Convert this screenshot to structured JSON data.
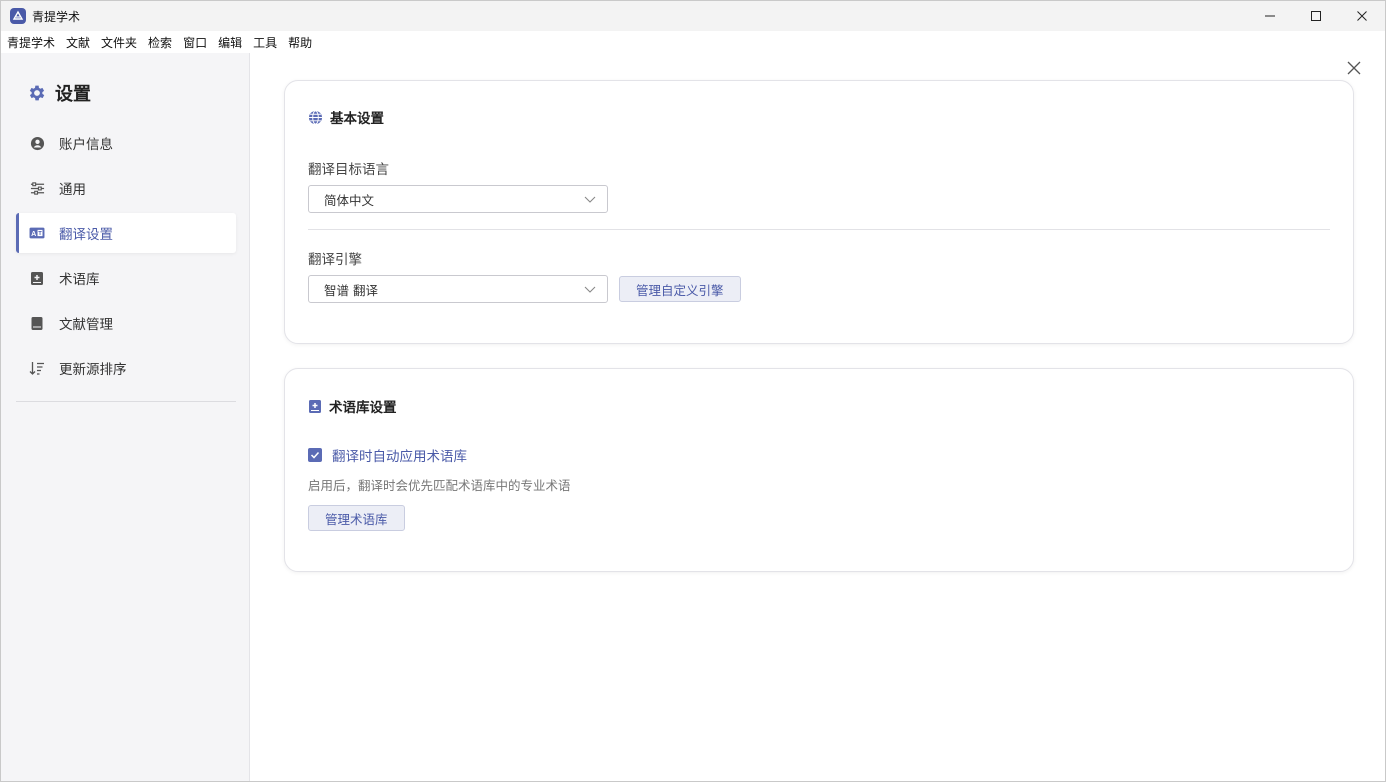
{
  "window": {
    "title": "青提学术",
    "icon": "app-logo-icon",
    "controls": [
      "minimize-icon",
      "maximize-icon",
      "close-icon"
    ]
  },
  "menubar": {
    "items": [
      "青提学术",
      "文献",
      "文件夹",
      "检索",
      "窗口",
      "编辑",
      "工具",
      "帮助"
    ]
  },
  "sidebar": {
    "title": "设置",
    "title_icon": "gear-icon",
    "items": [
      {
        "label": "账户信息",
        "icon": "user-icon",
        "active": false
      },
      {
        "label": "通用",
        "icon": "sliders-icon",
        "active": false
      },
      {
        "label": "翻译设置",
        "icon": "translate-icon",
        "active": true
      },
      {
        "label": "术语库",
        "icon": "term-book-icon",
        "active": false
      },
      {
        "label": "文献管理",
        "icon": "book-icon",
        "active": false
      },
      {
        "label": "更新源排序",
        "icon": "sort-icon",
        "active": false
      }
    ]
  },
  "main": {
    "close_icon": "close-icon",
    "basic": {
      "title": "基本设置",
      "icon": "globe-icon",
      "target_lang_label": "翻译目标语言",
      "target_lang_value": "简体中文",
      "engine_label": "翻译引擎",
      "engine_value": "智谱 翻译",
      "manage_engine_button": "管理自定义引擎"
    },
    "glossary": {
      "title": "术语库设置",
      "icon": "term-book-icon",
      "auto_apply_label": "翻译时自动应用术语库",
      "auto_apply_checked": true,
      "hint": "启用后，翻译时会优先匹配术语库中的专业术语",
      "manage_button": "管理术语库"
    }
  },
  "colors": {
    "accent": "#5b6bb5",
    "accent_text": "#4a5aa8",
    "sidebar_bg": "#f5f5f7",
    "button_bg": "#eceef6"
  }
}
